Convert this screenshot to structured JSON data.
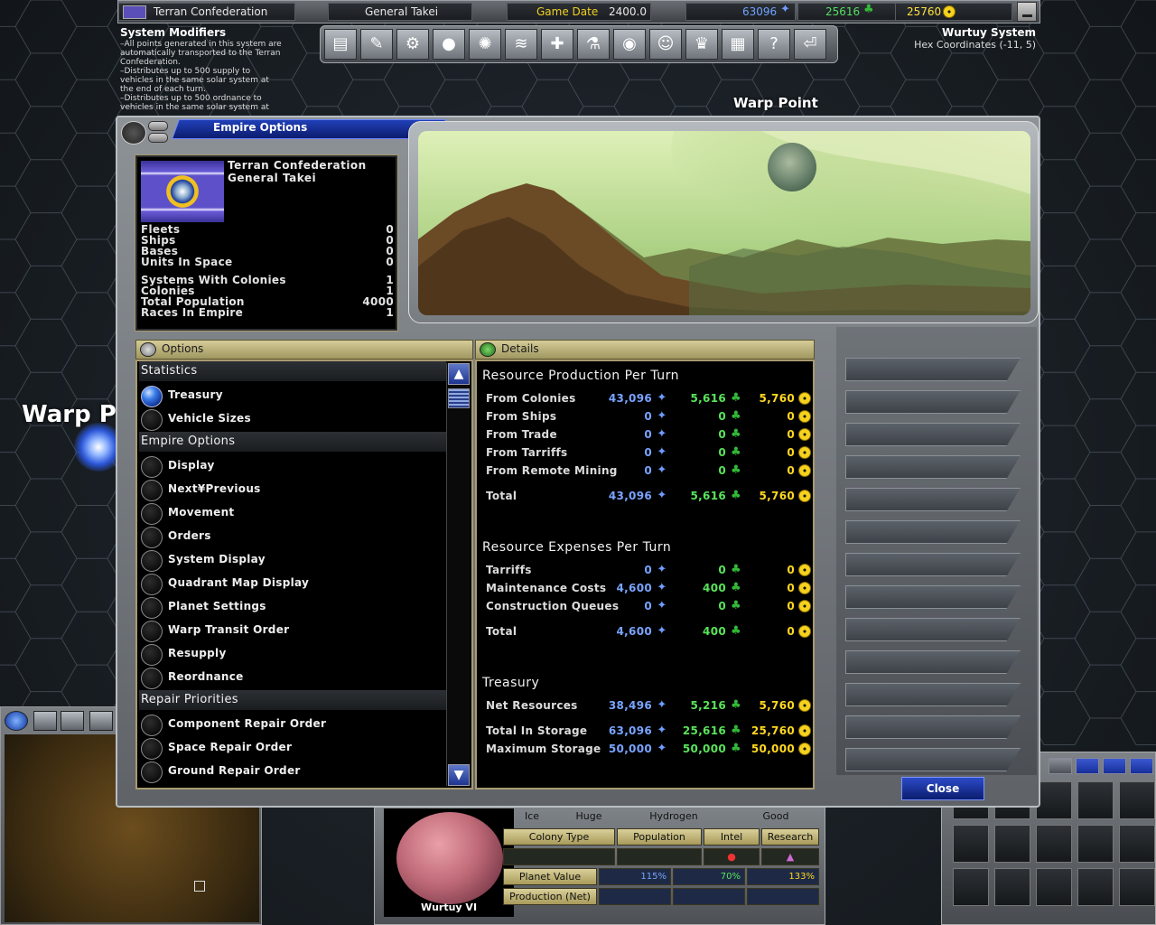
{
  "hud": {
    "empire_name": "Terran Confederation",
    "leader_name": "General Takei",
    "game_date_label": "Game Date",
    "game_date_value": "2400.0",
    "minerals": "63096",
    "organics": "25616",
    "radioactives": "25760"
  },
  "system_modifiers": {
    "title": "System Modifiers",
    "text": "–All points generated in this system are automatically transported to the Terran Confederation.\n–Distributes up to 500 supply to vehicles in the same solar system at the end of each turn.\n–Distributes up to 500 ordnance to vehicles in the same solar system at"
  },
  "system_info": {
    "name": "Wurtuy System",
    "coords": "Hex Coordinates (-11, 5)"
  },
  "map": {
    "warp_label_top": "Warp Point",
    "warp_label_left": "Warp P"
  },
  "toolbar": {
    "icons": [
      "news-icon",
      "tech-tree-icon",
      "ship-design-icon",
      "planets-icon",
      "colonies-icon",
      "fleets-icon",
      "construction-icon",
      "research-icon",
      "intel-icon",
      "diplomacy-icon",
      "empire-icon",
      "log-icon",
      "help-icon",
      "exit-icon"
    ]
  },
  "dialog": {
    "title": "Empire Options",
    "empire_name": "Terran Confederation",
    "leader_name": "General Takei",
    "stats_group1": [
      {
        "label": "Fleets",
        "value": "0"
      },
      {
        "label": "Ships",
        "value": "0"
      },
      {
        "label": "Bases",
        "value": "0"
      },
      {
        "label": "Units In Space",
        "value": "0"
      }
    ],
    "stats_group2": [
      {
        "label": "Systems With Colonies",
        "value": "1"
      },
      {
        "label": "Colonies",
        "value": "1"
      },
      {
        "label": "Total Population",
        "value": "4000"
      },
      {
        "label": "Races In Empire",
        "value": "1"
      }
    ],
    "options_header": "Options",
    "details_header": "Details",
    "close_label": "Close",
    "options": {
      "statistics_title": "Statistics",
      "statistics": [
        "Treasury",
        "Vehicle Sizes"
      ],
      "empire_title": "Empire Options",
      "empire_options": [
        "Display",
        "Next¥Previous",
        "Movement",
        "Orders",
        "System Display",
        "Quadrant Map Display",
        "Planet Settings",
        "Warp Transit Order",
        "Resupply",
        "Reordnance"
      ],
      "repair_title": "Repair Priorities",
      "repair": [
        "Component Repair Order",
        "Space Repair Order",
        "Ground Repair Order"
      ],
      "selected": "Treasury"
    },
    "details": {
      "production_title": "Resource Production Per Turn",
      "production_rows": [
        {
          "label": "From Colonies",
          "min": "43,096",
          "org": "5,616",
          "rad": "5,760"
        },
        {
          "label": "From Ships",
          "min": "0",
          "org": "0",
          "rad": "0"
        },
        {
          "label": "From Trade",
          "min": "0",
          "org": "0",
          "rad": "0"
        },
        {
          "label": "From Tarriffs",
          "min": "0",
          "org": "0",
          "rad": "0"
        },
        {
          "label": "From Remote Mining",
          "min": "0",
          "org": "0",
          "rad": "0"
        }
      ],
      "production_total": {
        "label": "Total",
        "min": "43,096",
        "org": "5,616",
        "rad": "5,760"
      },
      "expenses_title": "Resource Expenses Per Turn",
      "expense_rows": [
        {
          "label": "Tarriffs",
          "min": "0",
          "org": "0",
          "rad": "0"
        },
        {
          "label": "Maintenance Costs",
          "min": "4,600",
          "org": "400",
          "rad": "0"
        },
        {
          "label": "Construction Queues",
          "min": "0",
          "org": "0",
          "rad": "0"
        }
      ],
      "expense_total": {
        "label": "Total",
        "min": "4,600",
        "org": "400",
        "rad": "0"
      },
      "treasury_title": "Treasury",
      "net": {
        "label": "Net Resources",
        "min": "38,496",
        "org": "5,216",
        "rad": "5,760"
      },
      "storage": {
        "label": "Total In Storage",
        "min": "63,096",
        "org": "25,616",
        "rad": "25,760"
      },
      "max_storage": {
        "label": "Maximum Storage",
        "min": "50,000",
        "org": "50,000",
        "rad": "50,000"
      }
    }
  },
  "planet_panel": {
    "name": "Wurtuy VI",
    "type": "Ice",
    "size": "Huge",
    "atmosphere": "Hydrogen",
    "condition": "Good",
    "col_colony_type": "Colony Type",
    "col_population": "Population",
    "col_intel": "Intel",
    "col_research": "Research",
    "planet_value_label": "Planet Value",
    "min_pct": "115%",
    "org_pct": "70%",
    "rad_pct": "133%",
    "production_label": "Production (Net)"
  },
  "colors": {
    "minerals": "#6fa3ff",
    "organics": "#55e060",
    "radioactives": "#ffe040",
    "dialog_title_bg": "#1a36a8"
  }
}
